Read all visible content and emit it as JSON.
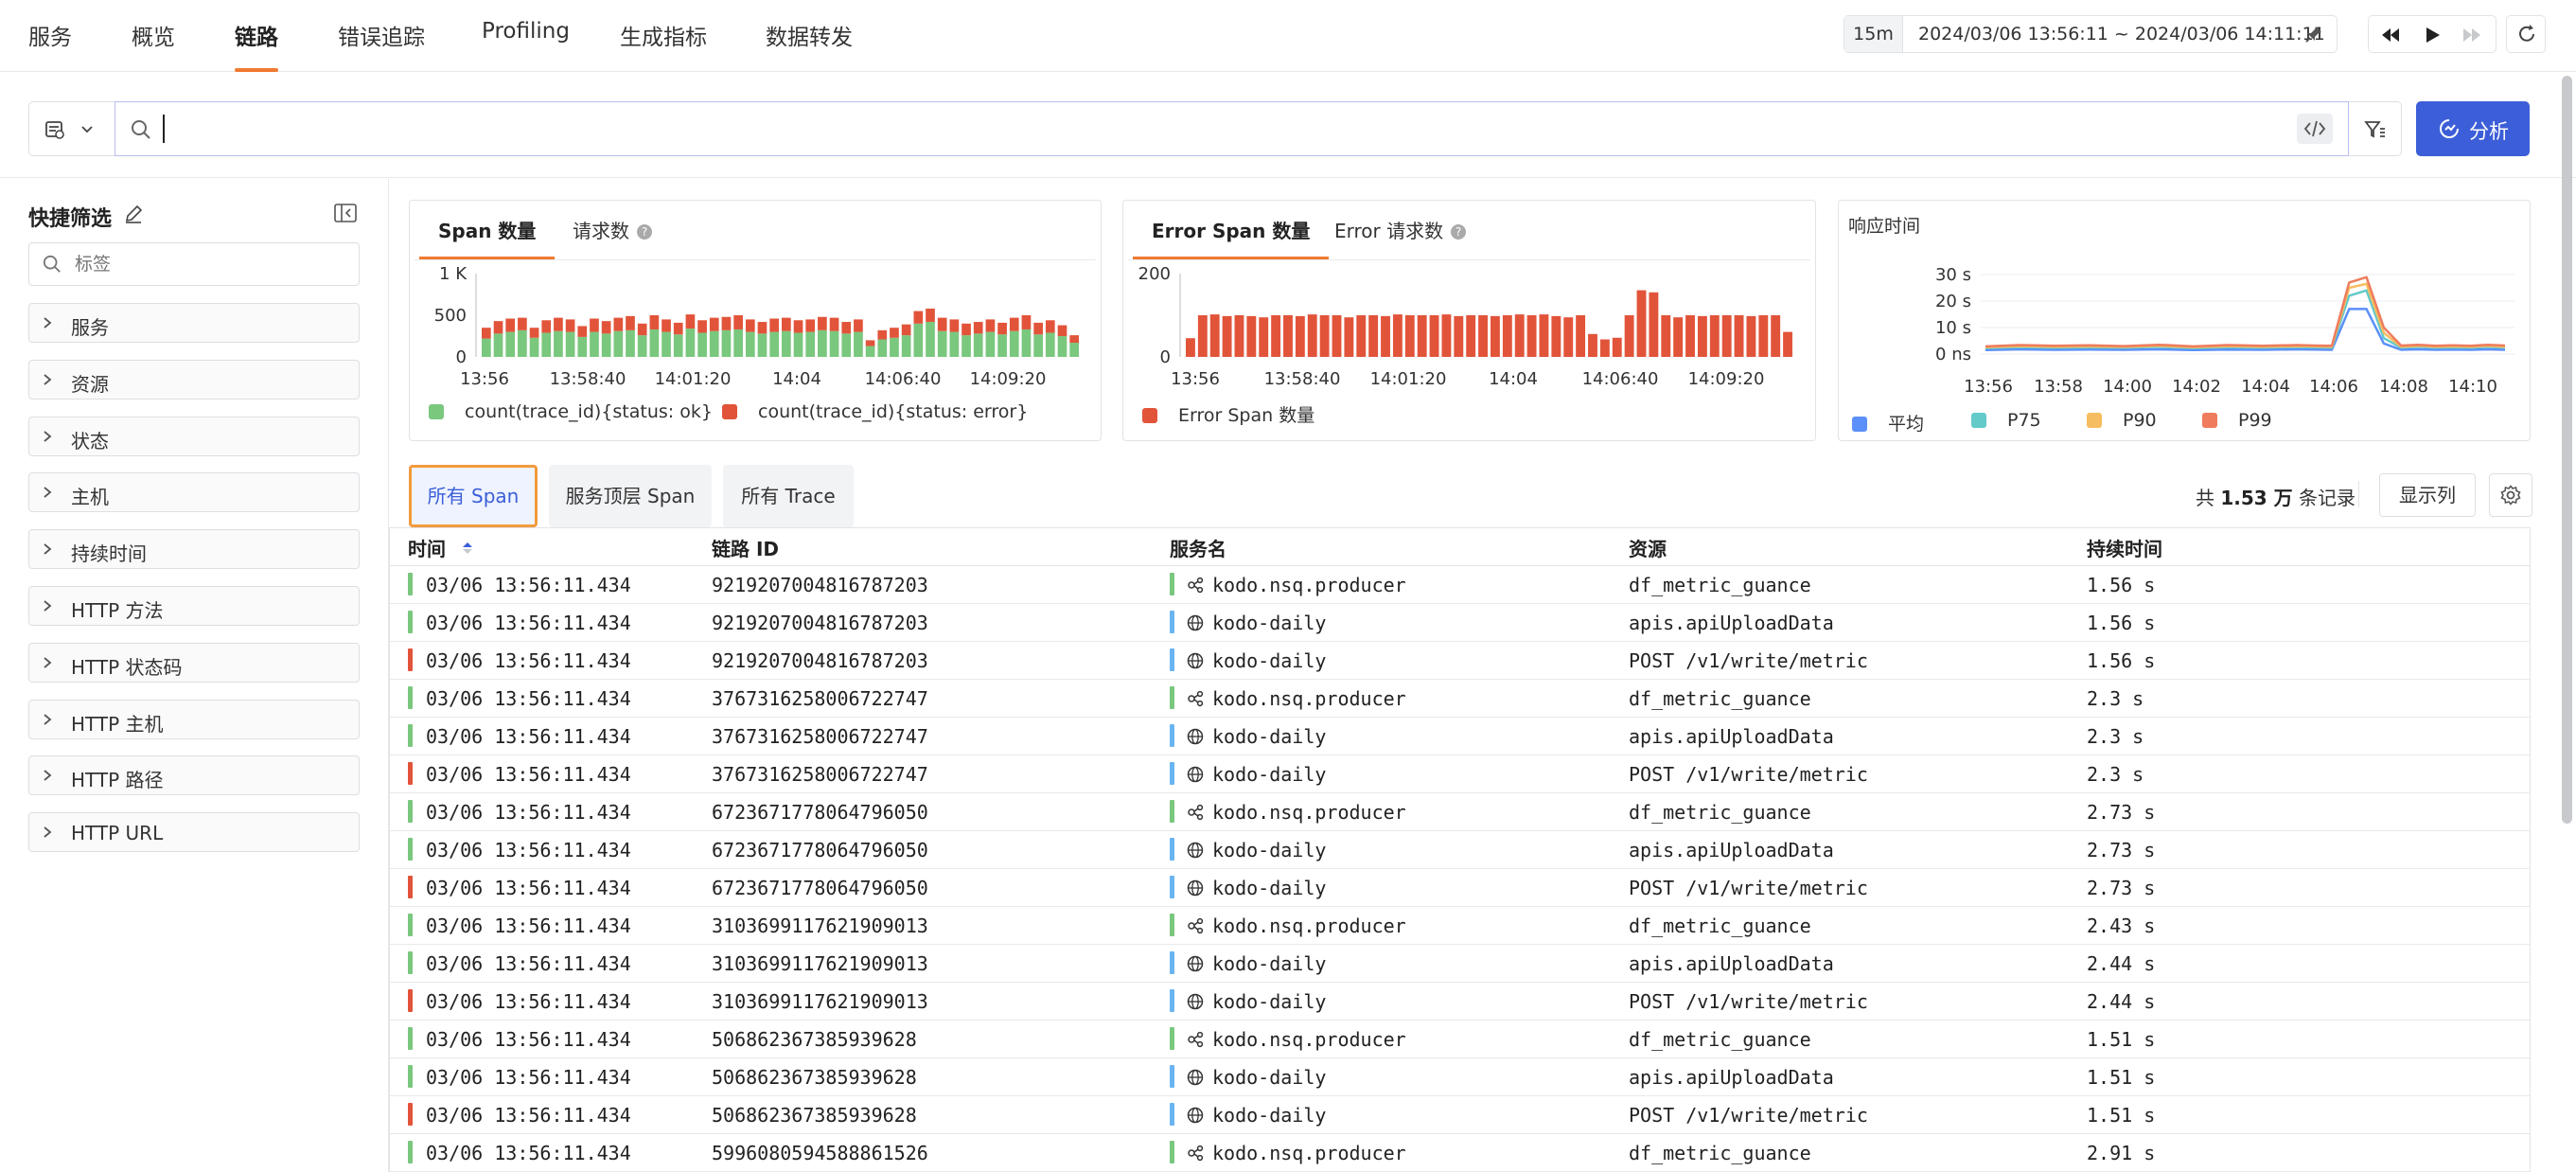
{
  "nav": {
    "tabs": [
      "服务",
      "概览",
      "链路",
      "错误追踪",
      "Profiling",
      "生成指标",
      "数据转发"
    ],
    "active_index": 2,
    "time_range_short": "15m",
    "time_range_value": "2024/03/06 13:56:11 ~ 2024/03/06 14:11:11"
  },
  "search": {
    "value": "",
    "analyze_label": "分析",
    "icons": [
      "datasource-icon",
      "search-icon",
      "code-icon",
      "filter-icon",
      "analyze-icon"
    ]
  },
  "sidebar": {
    "title": "快捷筛选",
    "search_placeholder": "标签",
    "items": [
      {
        "label": "服务"
      },
      {
        "label": "资源"
      },
      {
        "label": "状态"
      },
      {
        "label": "主机"
      },
      {
        "label": "持续时间"
      },
      {
        "label": "HTTP 方法"
      },
      {
        "label": "HTTP 状态码"
      },
      {
        "label": "HTTP 主机"
      },
      {
        "label": "HTTP 路径"
      },
      {
        "label": "HTTP URL"
      }
    ]
  },
  "cards": {
    "span_tab": "Span 数量",
    "request_tab": "请求数",
    "error_span_tab": "Error Span 数量",
    "error_request_tab": "Error 请求数",
    "response_title": "响应时间"
  },
  "chart_data": [
    {
      "type": "bar",
      "title": "Span 数量",
      "stacked": true,
      "x_tick_labels": [
        "13:56",
        "13:58:40",
        "14:01:20",
        "14:04",
        "14:06:40",
        "14:09:20"
      ],
      "y_tick_labels": [
        "1 K",
        "500",
        "0"
      ],
      "ylim": [
        0,
        1000
      ],
      "colors": {
        "ok": "#7ac77e",
        "error": "#e2543a"
      },
      "series": [
        {
          "name": "count(trace_id){status: ok}",
          "values": [
            220,
            280,
            300,
            320,
            230,
            290,
            310,
            300,
            240,
            300,
            280,
            310,
            320,
            260,
            330,
            300,
            270,
            340,
            290,
            310,
            320,
            330,
            300,
            280,
            300,
            310,
            290,
            300,
            320,
            310,
            280,
            300,
            130,
            210,
            230,
            260,
            400,
            420,
            310,
            300,
            260,
            280,
            300,
            270,
            310,
            330,
            270,
            290,
            250,
            170
          ]
        },
        {
          "name": "count(trace_id){status: error}",
          "values": [
            130,
            150,
            160,
            150,
            120,
            150,
            160,
            150,
            130,
            160,
            150,
            160,
            170,
            140,
            170,
            150,
            140,
            170,
            150,
            160,
            160,
            170,
            150,
            140,
            160,
            160,
            150,
            150,
            160,
            160,
            140,
            150,
            70,
            110,
            120,
            130,
            150,
            160,
            160,
            150,
            140,
            140,
            150,
            140,
            160,
            170,
            140,
            150,
            130,
            90
          ]
        }
      ],
      "legend_position": "bottom-left"
    },
    {
      "type": "bar",
      "title": "Error Span 数量",
      "x_tick_labels": [
        "13:56",
        "13:58:40",
        "14:01:20",
        "14:04",
        "14:06:40",
        "14:09:20"
      ],
      "y_tick_labels": [
        "200",
        "0"
      ],
      "ylim": [
        0,
        200
      ],
      "colors": {
        "error": "#e2543a"
      },
      "series": [
        {
          "name": "Error Span 数量",
          "values": [
            45,
            100,
            102,
            98,
            100,
            98,
            95,
            100,
            100,
            98,
            102,
            100,
            100,
            95,
            100,
            100,
            98,
            102,
            100,
            100,
            100,
            102,
            98,
            100,
            100,
            98,
            100,
            102,
            100,
            102,
            98,
            95,
            100,
            55,
            42,
            46,
            100,
            160,
            155,
            100,
            95,
            100,
            98,
            100,
            100,
            100,
            98,
            100,
            100,
            60
          ]
        }
      ],
      "legend_position": "bottom-left"
    },
    {
      "type": "line",
      "title": "响应时间",
      "x_tick_labels": [
        "13:56",
        "13:58",
        "14:00",
        "14:02",
        "14:04",
        "14:06",
        "14:08",
        "14:10"
      ],
      "y_tick_labels": [
        "30 s",
        "20 s",
        "10 s",
        "0 ns"
      ],
      "ylim": [
        0,
        30
      ],
      "x": [
        "13:56",
        "13:57",
        "13:58",
        "13:59",
        "14:00",
        "14:01",
        "14:02",
        "14:03",
        "14:04",
        "14:05",
        "14:05:30",
        "14:06",
        "14:06:30",
        "14:07",
        "14:07:30",
        "14:08",
        "14:08:30",
        "14:09",
        "14:09:30",
        "14:10",
        "14:10:30",
        "14:11"
      ],
      "series": [
        {
          "name": "平均",
          "color": "#5b8ff9",
          "values": [
            1.5,
            1.8,
            1.6,
            1.7,
            1.6,
            1.8,
            1.5,
            1.7,
            1.6,
            1.8,
            1.7,
            1.6,
            17,
            17,
            4,
            1.6,
            1.8,
            1.6,
            1.7,
            1.6,
            1.8,
            1.6
          ]
        },
        {
          "name": "P75",
          "color": "#63c9c9",
          "values": [
            2.3,
            2.6,
            2.4,
            2.5,
            2.4,
            2.7,
            2.3,
            2.6,
            2.4,
            2.6,
            2.5,
            2.4,
            22,
            24,
            6,
            2.4,
            2.7,
            2.4,
            2.5,
            2.4,
            2.7,
            2.4
          ]
        },
        {
          "name": "P90",
          "color": "#f6bd60",
          "values": [
            2.6,
            3.0,
            2.8,
            2.9,
            2.7,
            3.1,
            2.6,
            3.0,
            2.8,
            3.0,
            2.9,
            2.8,
            25,
            26.5,
            8,
            2.8,
            3.1,
            2.8,
            2.9,
            2.8,
            3.1,
            2.8
          ]
        },
        {
          "name": "P99",
          "color": "#ee7c5d",
          "values": [
            2.9,
            3.4,
            3.1,
            3.3,
            3.0,
            3.5,
            2.9,
            3.4,
            3.1,
            3.4,
            3.2,
            3.1,
            27,
            29,
            10,
            3.2,
            3.5,
            3.1,
            3.3,
            3.1,
            3.5,
            3.2
          ]
        }
      ],
      "legend_position": "bottom-left"
    }
  ],
  "view_tabs": [
    "所有 Span",
    "服务顶层 Span",
    "所有 Trace"
  ],
  "view_active_index": 0,
  "record_count": {
    "prefix": "共 ",
    "value": "1.53 万",
    "suffix": " 条记录"
  },
  "columns_button": "显示列",
  "table": {
    "headers": [
      "时间",
      "链路 ID",
      "服务名",
      "资源",
      "持续时间"
    ],
    "sort_column": "时间",
    "rows": [
      {
        "status": "ok",
        "time": "03/06 13:56:11.434",
        "trace_id": "9219207004816787203",
        "service": "kodo.nsq.producer",
        "service_type": "producer",
        "resource": "df_metric_guance",
        "duration": "1.56 s"
      },
      {
        "status": "ok",
        "time": "03/06 13:56:11.434",
        "trace_id": "9219207004816787203",
        "service": "kodo-daily",
        "service_type": "web",
        "resource": "apis.apiUploadData",
        "duration": "1.56 s"
      },
      {
        "status": "error",
        "time": "03/06 13:56:11.434",
        "trace_id": "9219207004816787203",
        "service": "kodo-daily",
        "service_type": "web",
        "resource": "POST /v1/write/metric",
        "duration": "1.56 s"
      },
      {
        "status": "ok",
        "time": "03/06 13:56:11.434",
        "trace_id": "3767316258006722747",
        "service": "kodo.nsq.producer",
        "service_type": "producer",
        "resource": "df_metric_guance",
        "duration": "2.3 s"
      },
      {
        "status": "ok",
        "time": "03/06 13:56:11.434",
        "trace_id": "3767316258006722747",
        "service": "kodo-daily",
        "service_type": "web",
        "resource": "apis.apiUploadData",
        "duration": "2.3 s"
      },
      {
        "status": "error",
        "time": "03/06 13:56:11.434",
        "trace_id": "3767316258006722747",
        "service": "kodo-daily",
        "service_type": "web",
        "resource": "POST /v1/write/metric",
        "duration": "2.3 s"
      },
      {
        "status": "ok",
        "time": "03/06 13:56:11.434",
        "trace_id": "6723671778064796050",
        "service": "kodo.nsq.producer",
        "service_type": "producer",
        "resource": "df_metric_guance",
        "duration": "2.73 s"
      },
      {
        "status": "ok",
        "time": "03/06 13:56:11.434",
        "trace_id": "6723671778064796050",
        "service": "kodo-daily",
        "service_type": "web",
        "resource": "apis.apiUploadData",
        "duration": "2.73 s"
      },
      {
        "status": "error",
        "time": "03/06 13:56:11.434",
        "trace_id": "6723671778064796050",
        "service": "kodo-daily",
        "service_type": "web",
        "resource": "POST /v1/write/metric",
        "duration": "2.73 s"
      },
      {
        "status": "ok",
        "time": "03/06 13:56:11.434",
        "trace_id": "3103699117621909013",
        "service": "kodo.nsq.producer",
        "service_type": "producer",
        "resource": "df_metric_guance",
        "duration": "2.43 s"
      },
      {
        "status": "ok",
        "time": "03/06 13:56:11.434",
        "trace_id": "3103699117621909013",
        "service": "kodo-daily",
        "service_type": "web",
        "resource": "apis.apiUploadData",
        "duration": "2.44 s"
      },
      {
        "status": "error",
        "time": "03/06 13:56:11.434",
        "trace_id": "3103699117621909013",
        "service": "kodo-daily",
        "service_type": "web",
        "resource": "POST /v1/write/metric",
        "duration": "2.44 s"
      },
      {
        "status": "ok",
        "time": "03/06 13:56:11.434",
        "trace_id": "506862367385939628",
        "service": "kodo.nsq.producer",
        "service_type": "producer",
        "resource": "df_metric_guance",
        "duration": "1.51 s"
      },
      {
        "status": "ok",
        "time": "03/06 13:56:11.434",
        "trace_id": "506862367385939628",
        "service": "kodo-daily",
        "service_type": "web",
        "resource": "apis.apiUploadData",
        "duration": "1.51 s"
      },
      {
        "status": "error",
        "time": "03/06 13:56:11.434",
        "trace_id": "506862367385939628",
        "service": "kodo-daily",
        "service_type": "web",
        "resource": "POST /v1/write/metric",
        "duration": "1.51 s"
      },
      {
        "status": "ok",
        "time": "03/06 13:56:11.434",
        "trace_id": "5996080594588861526",
        "service": "kodo.nsq.producer",
        "service_type": "producer",
        "resource": "df_metric_guance",
        "duration": "2.91 s"
      }
    ]
  },
  "colors": {
    "accent": "#f07a32",
    "primary": "#3c5ed8",
    "status_ok": "#7ac77e",
    "status_error": "#e2543a",
    "service_producer": "#7ac77e",
    "service_web": "#6ab4f2"
  }
}
